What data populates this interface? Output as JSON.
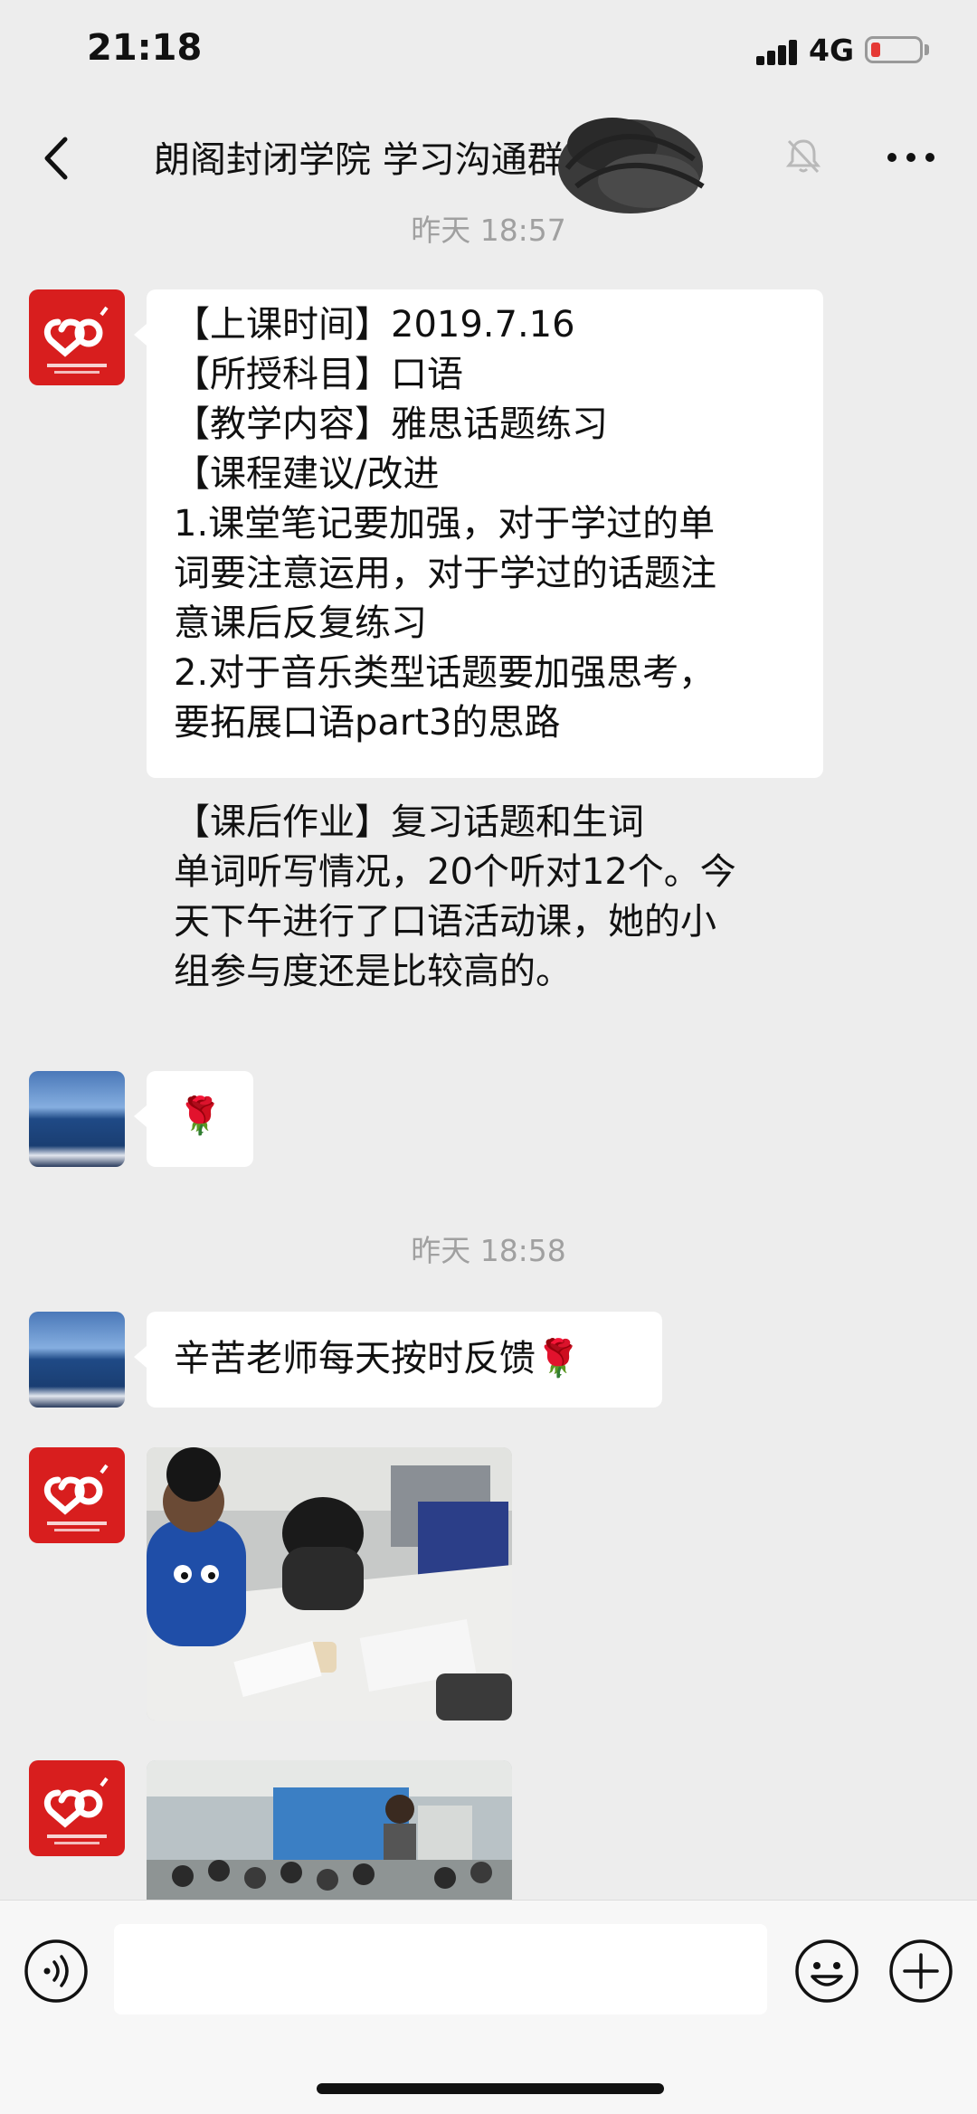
{
  "status_bar": {
    "time": "21:18",
    "network": "4G"
  },
  "header": {
    "title": "朗阁封闭学院·····学习沟通群(4)",
    "title_visible": "朗阁封闭学院  学习沟通群(4)"
  },
  "messages": {
    "sep1": "昨天 18:57",
    "m1_lines": [
      "【上课时间】2019.7.16",
      "【所授科目】口语",
      "【教学内容】雅思话题练习",
      "【课程建议/改进",
      "1.课堂笔记要加强，对于学过的单",
      "词要注意运用，对于学过的话题注",
      "意课后反复练习",
      "2.对于音乐类型话题要加强思考，",
      "要拓展口语part3的思路",
      "",
      "【课后作业】复习话题和生词",
      "单词听写情况，20个听对12个。今",
      "天下午进行了口语活动课，她的小",
      "组参与度还是比较高的。"
    ],
    "m2": "🌹",
    "sep2": "昨天 18:58",
    "m3": "辛苦老师每天按时反馈🌹"
  },
  "icons": {
    "back": "chevron-left-icon",
    "mute": "bell-muted-icon",
    "more": "more-dots-icon",
    "voice": "voice-icon",
    "emoji": "emoji-icon",
    "plus": "plus-icon",
    "logo_red": "heart-logo-icon"
  },
  "colors": {
    "logo_red": "#d81e1e",
    "background": "#ededed",
    "bubble": "#ffffff"
  }
}
